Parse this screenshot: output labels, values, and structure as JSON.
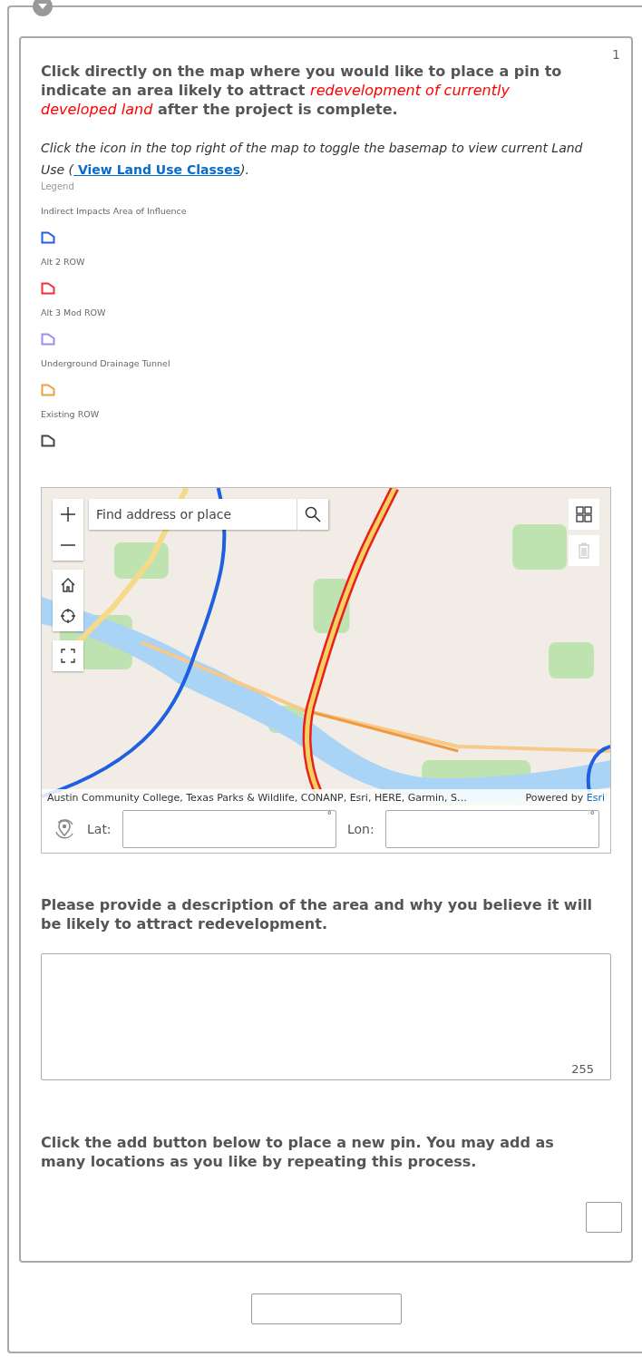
{
  "question_number": "1",
  "question1": {
    "parts": [
      {
        "kind": "plain",
        "text": "Click directly on the map where you would like to place a pin to indicate an area likely to attract "
      },
      {
        "kind": "emphasis",
        "text": "redevelopment of currently developed land"
      },
      {
        "kind": "plain",
        "text": " after the project is complete."
      }
    ]
  },
  "hint": {
    "before": "Click the icon in the top right of the map to toggle the basemap to view current Land Use  (",
    "link": " View Land Use Classes",
    "after": ")."
  },
  "legend": {
    "title": "Legend",
    "items": [
      {
        "label": "Indirect Impacts Area of Influence",
        "color": "#1f5fe0"
      },
      {
        "label": "Alt 2 ROW",
        "color": "#f0303c"
      },
      {
        "label": "Alt 3 Mod ROW",
        "color": "#a08ce8"
      },
      {
        "label": "Underground Drainage Tunnel",
        "color": "#f0a040"
      },
      {
        "label": "Existing ROW",
        "color": "#444444"
      }
    ]
  },
  "map": {
    "search_placeholder": "Find address or place",
    "attribution": "Austin Community College, Texas Parks & Wildlife, CONANP, Esri, HERE, Garmin, S…",
    "powered_by": "Powered by",
    "powered_link": "Esri"
  },
  "coordinates": {
    "lat_label": "Lat:",
    "lat_unit": "°",
    "lon_label": "Lon:",
    "lon_unit": "°"
  },
  "question2": {
    "label": "Please provide a description of the area and why you believe it will be likely to attract redevelopment.",
    "counter": "255"
  },
  "question3": {
    "label": "Click the add button below to place a new pin. You may add as many locations as you like by repeating this process."
  }
}
